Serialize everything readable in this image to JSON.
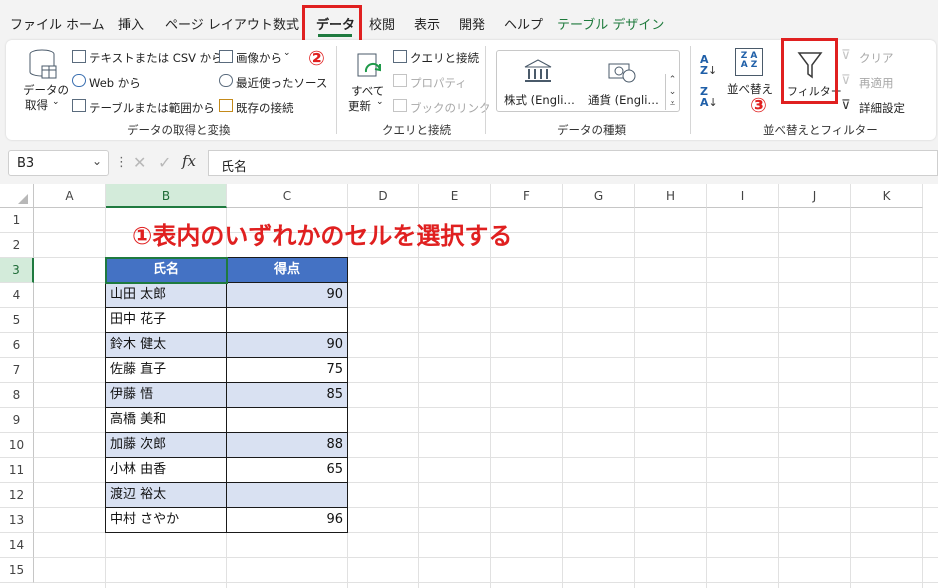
{
  "tabs": [
    "ファイル",
    "ホーム",
    "挿入",
    "ページ レイアウト",
    "数式",
    "データ",
    "校閲",
    "表示",
    "開発",
    "ヘルプ",
    "テーブル デザイン"
  ],
  "markers": {
    "one": "①",
    "two": "②",
    "three": "③"
  },
  "ribbon": {
    "get_data": [
      "データの",
      "取得"
    ],
    "text_csv": "テキストまたは CSV から",
    "web": "Web から",
    "table_range": "テーブルまたは範囲から",
    "from_image": "画像から",
    "recent_sources": "最近使ったソース",
    "existing_conn": "既存の接続",
    "group_get": "データの取得と変換",
    "refresh_all": [
      "すべて",
      "更新"
    ],
    "queries_conn": "クエリと接続",
    "properties": "プロパティ",
    "book_links": "ブックのリンク",
    "group_queries": "クエリと接続",
    "stocks": "株式 (Engli…",
    "currency": "通貨 (Engli…",
    "group_types": "データの種類",
    "sort": "並べ替え",
    "filter": "フィルター",
    "clear": "クリア",
    "reapply": "再適用",
    "advanced": "詳細設定",
    "group_sort": "並べ替えとフィルター"
  },
  "namebox": "B3",
  "formula": "氏名",
  "fx": "fx",
  "columns": [
    "A",
    "B",
    "C",
    "D",
    "E",
    "F",
    "G",
    "H",
    "I",
    "J",
    "K"
  ],
  "rows": [
    "1",
    "2",
    "3",
    "4",
    "5",
    "6",
    "7",
    "8",
    "9",
    "10",
    "11",
    "12",
    "13",
    "14",
    "15"
  ],
  "instruction": "①表内のいずれかのセルを選択する",
  "table": {
    "headers": [
      "氏名",
      "得点"
    ],
    "rows": [
      [
        "山田 太郎",
        "90"
      ],
      [
        "田中 花子",
        ""
      ],
      [
        "鈴木 健太",
        "90"
      ],
      [
        "佐藤 直子",
        "75"
      ],
      [
        "伊藤 悟",
        "85"
      ],
      [
        "高橋 美和",
        ""
      ],
      [
        "加藤 次郎",
        "88"
      ],
      [
        "小林 由香",
        "65"
      ],
      [
        "渡辺 裕太",
        ""
      ],
      [
        "中村 さやか",
        "96"
      ]
    ]
  },
  "colors": {
    "accent_red": "#e02020",
    "table_header": "#4472c4",
    "band": "#d9e1f2",
    "excel_green": "#1f7a3f"
  }
}
